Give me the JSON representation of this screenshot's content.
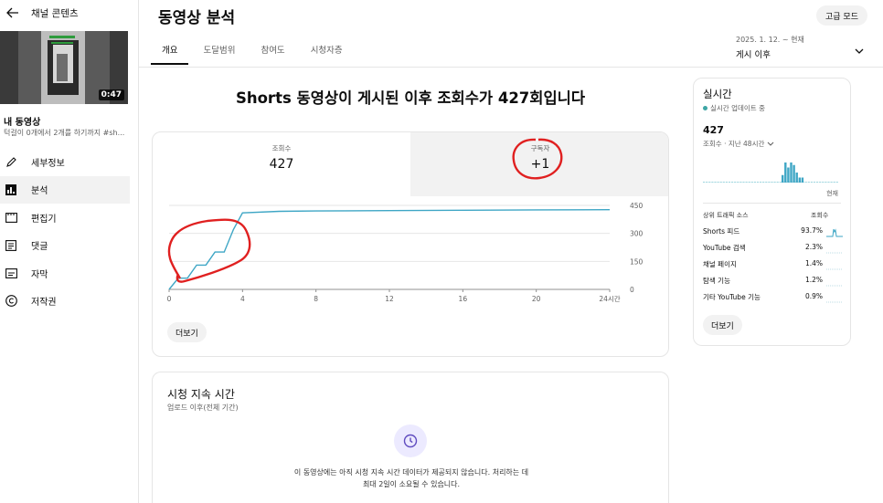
{
  "sidebar": {
    "back_label": "채널 콘텐츠",
    "thumbnail_duration": "0:47",
    "video_title": "내 동영상",
    "video_desc": "턱걸이 0개에서 2개를 하기까지 #sh...",
    "nav": [
      {
        "label": "세부정보",
        "icon": "pencil-icon"
      },
      {
        "label": "분석",
        "icon": "analytics-icon",
        "active": true
      },
      {
        "label": "편집기",
        "icon": "editor-icon"
      },
      {
        "label": "댓글",
        "icon": "comments-icon"
      },
      {
        "label": "자막",
        "icon": "subtitles-icon"
      },
      {
        "label": "저작권",
        "icon": "copyright-icon"
      }
    ]
  },
  "header": {
    "title": "동영상 분석",
    "advanced_mode": "고급 모드",
    "tabs": [
      {
        "label": "개요",
        "active": true
      },
      {
        "label": "도달범위"
      },
      {
        "label": "참여도"
      },
      {
        "label": "시청자층"
      }
    ],
    "date_range_line1": "2025. 1. 12. ~ 현재",
    "date_range_line2": "게시 이후"
  },
  "overview": {
    "headline": "Shorts 동영상이 게시된 이후 조회수가 427회입니다",
    "metrics": [
      {
        "label": "조회수",
        "value": "427"
      },
      {
        "label": "구독자",
        "value": "+1"
      }
    ],
    "more": "더보기"
  },
  "chart_data": {
    "type": "line",
    "x": [
      0,
      0.5,
      1,
      1.5,
      2,
      2.5,
      3,
      3.5,
      4,
      6,
      8,
      12,
      16,
      20,
      24
    ],
    "series": [
      {
        "values": [
          0,
          60,
          60,
          130,
          130,
          200,
          200,
          320,
          410,
          418,
          420,
          422,
          424,
          426,
          427
        ]
      }
    ],
    "x_ticks": [
      "0",
      "4",
      "8",
      "12",
      "16",
      "20",
      "24시간"
    ],
    "y_ticks": [
      "0",
      "150",
      "300",
      "450"
    ],
    "xlim": [
      0,
      24
    ],
    "ylim": [
      0,
      450
    ],
    "color": "#3ea6c5"
  },
  "watch_time": {
    "title": "시청 지속 시간",
    "subtitle": "업로드 이후(전체 기간)",
    "message": "이 동영상에는 아직 시청 지속 시간 데이터가 제공되지 않습니다. 처리하는 데 최대 2일이 소요될 수 있습니다."
  },
  "realtime": {
    "title": "실시간",
    "live": "실시간 업데이트 중",
    "count": "427",
    "period": "조회수 · 지난 48시간",
    "now": "현재",
    "hist": [
      0,
      0,
      0,
      0,
      0,
      0,
      0,
      0,
      0,
      0,
      0,
      0,
      0,
      0,
      0,
      0,
      0,
      0,
      0,
      0,
      0,
      0,
      0,
      0,
      0,
      0,
      0,
      0,
      0,
      0,
      0,
      0,
      0,
      0,
      0,
      0,
      0,
      0,
      0,
      0,
      0,
      0,
      0,
      0,
      0,
      1,
      1,
      0,
      0,
      0,
      0,
      0,
      0,
      0,
      0,
      0,
      0,
      0,
      0,
      0,
      0,
      0,
      0,
      0,
      0,
      0,
      0,
      0,
      0,
      0,
      0,
      0,
      0,
      0,
      0,
      0,
      0,
      0,
      0,
      0,
      0,
      0,
      0,
      0,
      0,
      0,
      0,
      0,
      0,
      0,
      0,
      0,
      0,
      0,
      0,
      0,
      0
    ],
    "hist_main": [
      3,
      8,
      6,
      8,
      7,
      4,
      2,
      2
    ],
    "traffic_header": "상위 트래픽 소스",
    "views_header": "조회수",
    "sources": [
      {
        "name": "Shorts 피드",
        "pct": "93.7%"
      },
      {
        "name": "YouTube 검색",
        "pct": "2.3%"
      },
      {
        "name": "채널 페이지",
        "pct": "1.4%"
      },
      {
        "name": "탐색 기능",
        "pct": "1.2%"
      },
      {
        "name": "기타 YouTube 기능",
        "pct": "0.9%"
      }
    ],
    "more": "더보기"
  }
}
